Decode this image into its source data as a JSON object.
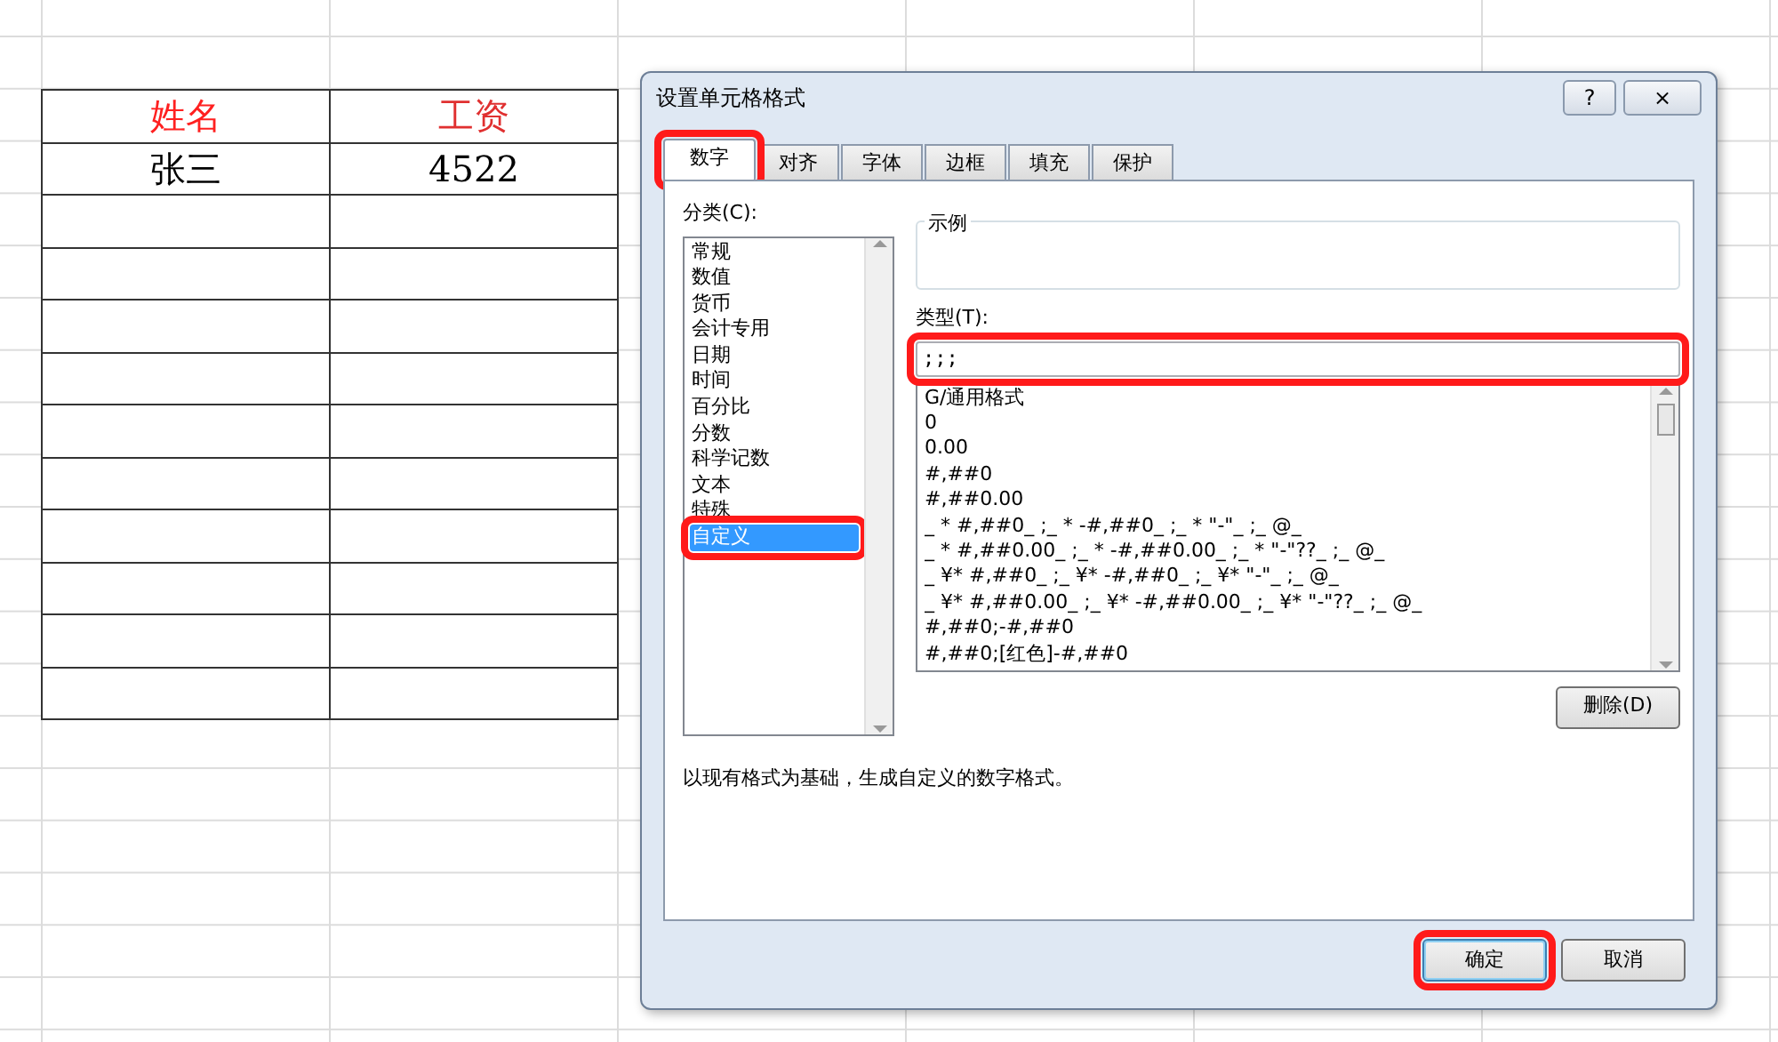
{
  "sheet_table": {
    "columns": [
      {
        "label": "姓名",
        "color": "#ff2020"
      },
      {
        "label": "工资",
        "color": "#e03030"
      }
    ],
    "rows": [
      [
        "张三",
        "4522"
      ],
      [
        "",
        ""
      ],
      [
        "",
        ""
      ],
      [
        "",
        ""
      ],
      [
        "",
        ""
      ],
      [
        "",
        ""
      ],
      [
        "",
        ""
      ],
      [
        "",
        ""
      ],
      [
        "",
        ""
      ],
      [
        "",
        ""
      ],
      [
        "",
        ""
      ]
    ]
  },
  "dialog": {
    "title": "设置单元格格式",
    "help": "?",
    "close": "×",
    "tabs": [
      {
        "label": "数字",
        "selected": true,
        "annotated": true
      },
      {
        "label": "对齐",
        "selected": false,
        "annotated": false
      },
      {
        "label": "字体",
        "selected": false,
        "annotated": false
      },
      {
        "label": "边框",
        "selected": false,
        "annotated": false
      },
      {
        "label": "填充",
        "selected": false,
        "annotated": false
      },
      {
        "label": "保护",
        "selected": false,
        "annotated": false
      }
    ],
    "category_label": "分类(C):",
    "categories": [
      {
        "label": "常规",
        "selected": false
      },
      {
        "label": "数值",
        "selected": false
      },
      {
        "label": "货币",
        "selected": false
      },
      {
        "label": "会计专用",
        "selected": false
      },
      {
        "label": "日期",
        "selected": false
      },
      {
        "label": "时间",
        "selected": false
      },
      {
        "label": "百分比",
        "selected": false
      },
      {
        "label": "分数",
        "selected": false
      },
      {
        "label": "科学记数",
        "selected": false
      },
      {
        "label": "文本",
        "selected": false
      },
      {
        "label": "特殊",
        "selected": false
      },
      {
        "label": "自定义",
        "selected": true,
        "annotated": true
      }
    ],
    "sample_label": "示例",
    "type_label": "类型(T):",
    "type_value": ";;;",
    "type_annotated": true,
    "formats": [
      "G/通用格式",
      "0",
      "0.00",
      "#,##0",
      "#,##0.00",
      "_ * #,##0_ ;_ * -#,##0_ ;_ * \"-\"_ ;_ @_",
      "_ * #,##0.00_ ;_ * -#,##0.00_ ;_ * \"-\"??_ ;_ @_",
      "_ ¥* #,##0_ ;_ ¥* -#,##0_ ;_ ¥* \"-\"_ ;_ @_",
      "_ ¥* #,##0.00_ ;_ ¥* -#,##0.00_ ;_ ¥* \"-\"??_ ;_ @_",
      "#,##0;-#,##0",
      "#,##0;[红色]-#,##0"
    ],
    "delete_button": "删除(D)",
    "description": "以现有格式为基础，生成自定义的数字格式。",
    "buttons": [
      {
        "label": "确定",
        "default": true,
        "annotated": true
      },
      {
        "label": "取消",
        "default": false,
        "annotated": false
      }
    ]
  }
}
